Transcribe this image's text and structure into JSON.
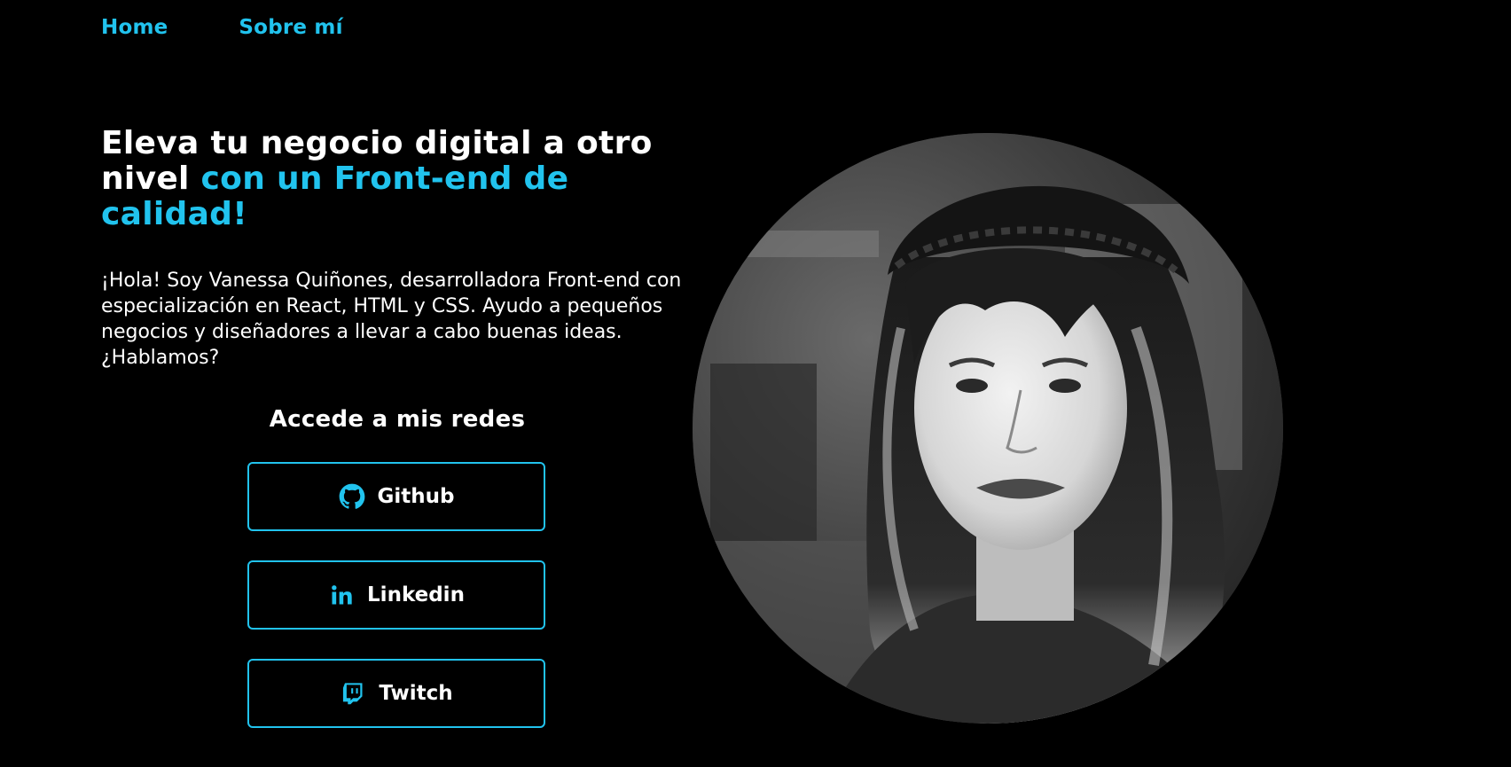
{
  "nav": {
    "items": [
      {
        "label": "Home"
      },
      {
        "label": "Sobre mí"
      }
    ]
  },
  "hero": {
    "headline_plain": "Eleva tu negocio digital a otro nivel ",
    "headline_accent": "con un Front-end de calidad!",
    "intro": "¡Hola! Soy Vanessa Quiñones, desarrolladora Front-end con especialización en React, HTML y CSS. Ayudo a pequeños negocios y diseñadores a llevar a cabo buenas ideas. ¿Hablamos?"
  },
  "socials": {
    "title": "Accede a mis redes",
    "links": [
      {
        "label": "Github",
        "icon": "github-icon"
      },
      {
        "label": "Linkedin",
        "icon": "linkedin-icon"
      },
      {
        "label": "Twitch",
        "icon": "twitch-icon"
      }
    ]
  },
  "portrait": {
    "description": "portrait-photo"
  },
  "colors": {
    "background": "#000000",
    "accent": "#21c3ee",
    "text": "#ffffff"
  }
}
